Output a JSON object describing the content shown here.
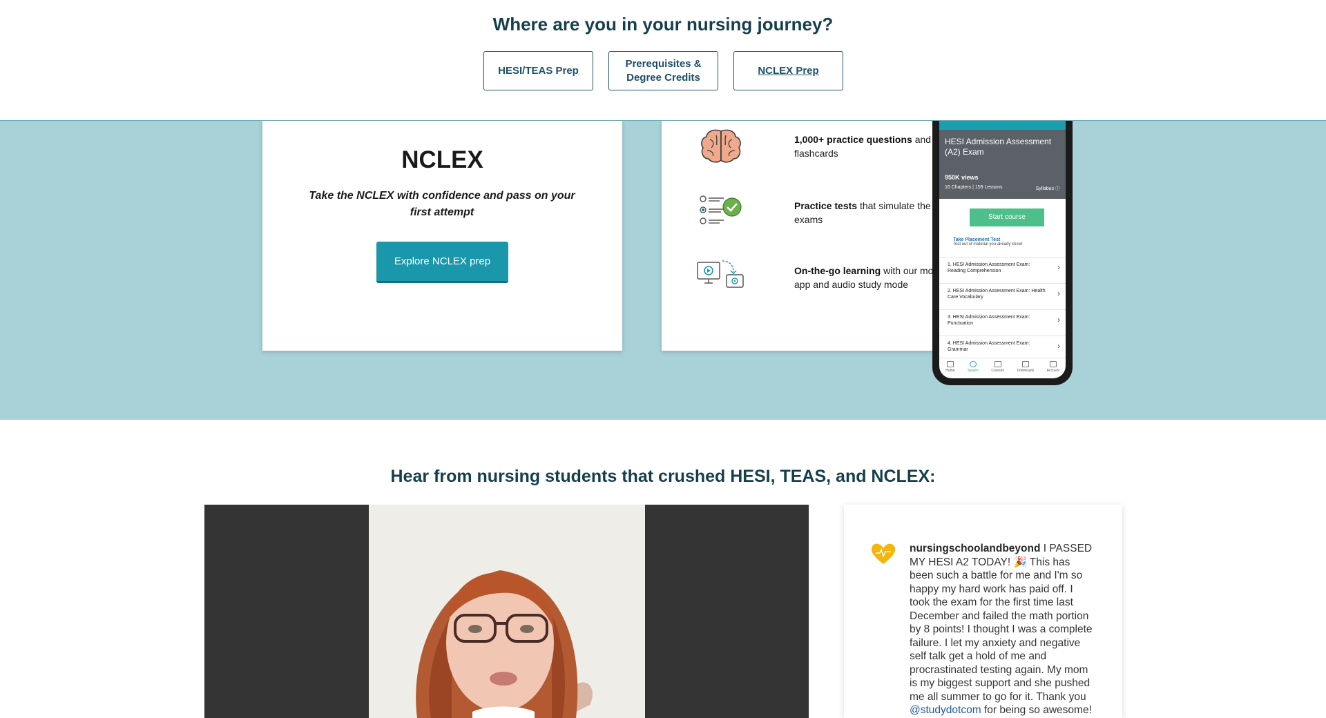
{
  "header": {
    "title": "Where are you in your nursing journey?",
    "buttons": [
      {
        "label": "HESI/TEAS Prep"
      },
      {
        "label": "Prerequisites &\nDegree Credits"
      },
      {
        "label": "NCLEX Prep"
      }
    ]
  },
  "nclex_card": {
    "title": "NCLEX",
    "tagline": "Take the NCLEX with confidence and pass on your first attempt",
    "button_label": "Explore NCLEX prep"
  },
  "features": [
    {
      "icon": "brain-icon",
      "bold": "1,000+ practice questions",
      "rest": " and flashcards"
    },
    {
      "icon": "checklist-icon",
      "bold": "Practice tests",
      "rest": " that simulate the exams"
    },
    {
      "icon": "devices-icon",
      "bold": "On-the-go learning",
      "rest": " with our mobile app and audio study mode"
    }
  ],
  "phone": {
    "course_title": "HESI Admission Assessment (A2) Exam",
    "views": "950K views",
    "meta": "16 Chapters | 159 Lessons",
    "syllabus": "Syllabus ⓘ",
    "start_label": "Start course",
    "placement_title": "Take Placement Test",
    "placement_sub": "Test out of material you already know!",
    "lessons": [
      "1. HESI Admission Assessment Exam: Reading Comprehension",
      "2. HESI Admission Assessment Exam: Health Care Vocabulary",
      "3. HESI Admission Assessment Exam: Punctuation",
      "4. HESI Admission Assessment Exam: Grammar"
    ],
    "nav": [
      "Home",
      "Search",
      "Courses",
      "Downloads",
      "Account"
    ]
  },
  "testimonials": {
    "title": "Hear from nursing students that crushed HESI, TEAS, and NCLEX:",
    "instagram": {
      "username": "nursingschoolandbeyond",
      "text_before_mention": " I PASSED MY HESI A2 TODAY! 🎉 This has been such a battle for me and I'm so happy my hard work has paid off. I took the exam for the first time last December and failed the math portion by 8 points! I thought I was a complete failure. I let my anxiety and negative self talk get a hold of me and procrastinated testing again. My mom is my biggest support and she pushed me all summer to go for it. Thank you ",
      "mention": "@studydotcom",
      "text_after_mention": " for being so awesome!"
    }
  },
  "colors": {
    "heading": "#163f4c",
    "teal_band": "#a8d1d8",
    "primary_button": "#1b97ac",
    "start_button": "#4cbf8a"
  }
}
